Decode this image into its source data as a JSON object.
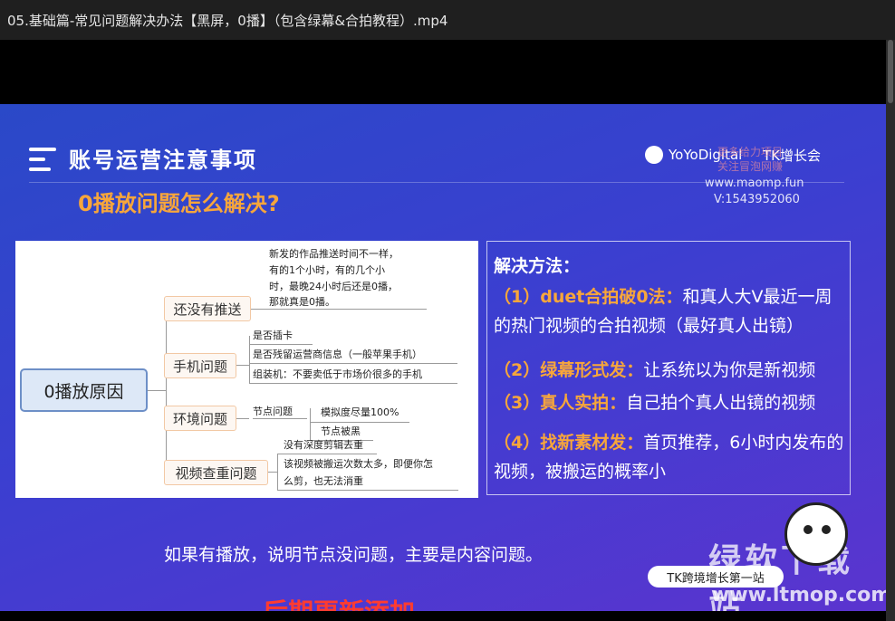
{
  "window": {
    "title": "05.基础篇-常见问题解决办法【黑屏，0播】（包含绿幕&合拍教程）.mp4"
  },
  "slide": {
    "title": "账号运营注意事项",
    "subtitle": "0播放问题怎么解决?",
    "logo_text": "YoYoDigital",
    "logo2_text": "TK增长会",
    "watermark_lines": [
      "更多给力项目",
      "关注冒泡网赚"
    ],
    "watermark_web": "www.maomp.fun",
    "watermark_v": "V:1543952060",
    "mindmap": {
      "root": "0播放原因",
      "branches": [
        {
          "label": "还没有推送",
          "leaves": [
            "新发的作品推送时间不一样，",
            "有的1个小时，有的几个小",
            "时，最晚24小时后还是0播，",
            "那就真是0播。"
          ]
        },
        {
          "label": "手机问题",
          "leaves": [
            "是否插卡",
            "是否残留运营商信息（一般苹果手机）",
            "组装机：不要卖低于市场价很多的手机"
          ]
        },
        {
          "label": "环境问题",
          "sub": "节点问题",
          "leaves": [
            "模拟度尽量100%",
            "节点被黑"
          ]
        },
        {
          "label": "视频查重问题",
          "leaves": [
            "没有深度剪辑去重",
            "该视频被搬运次数太多，即便你怎",
            "么剪，也无法消重"
          ]
        }
      ]
    },
    "solution": {
      "heading": "解决方法：",
      "items": [
        {
          "num": "（1）duet合拍破0法：",
          "text": "和真人大V最近一周的热门视频的合拍视频（最好真人出镜）"
        },
        {
          "num": "（2）绿幕形式发：",
          "text": "让系统以为你是新视频"
        },
        {
          "num": "（3）真人实拍：",
          "text": "自己拍个真人出镜的视频"
        },
        {
          "num": "（4）找新素材发：",
          "text": "首页推荐，6小时内发布的视频，被搬运的概率小"
        }
      ]
    },
    "bottom_text": "如果有播放，说明节点没问题，主要是内容问题。",
    "red_text": "后期更新添加",
    "badge_text": "TK跨境增长第一站",
    "brand_text": "绿软下载站",
    "site_text": "www.ltmop.com"
  },
  "colors": {
    "accent": "#f7a63b",
    "titlebar": "#1f1f1f",
    "red": "#ff3b30"
  }
}
